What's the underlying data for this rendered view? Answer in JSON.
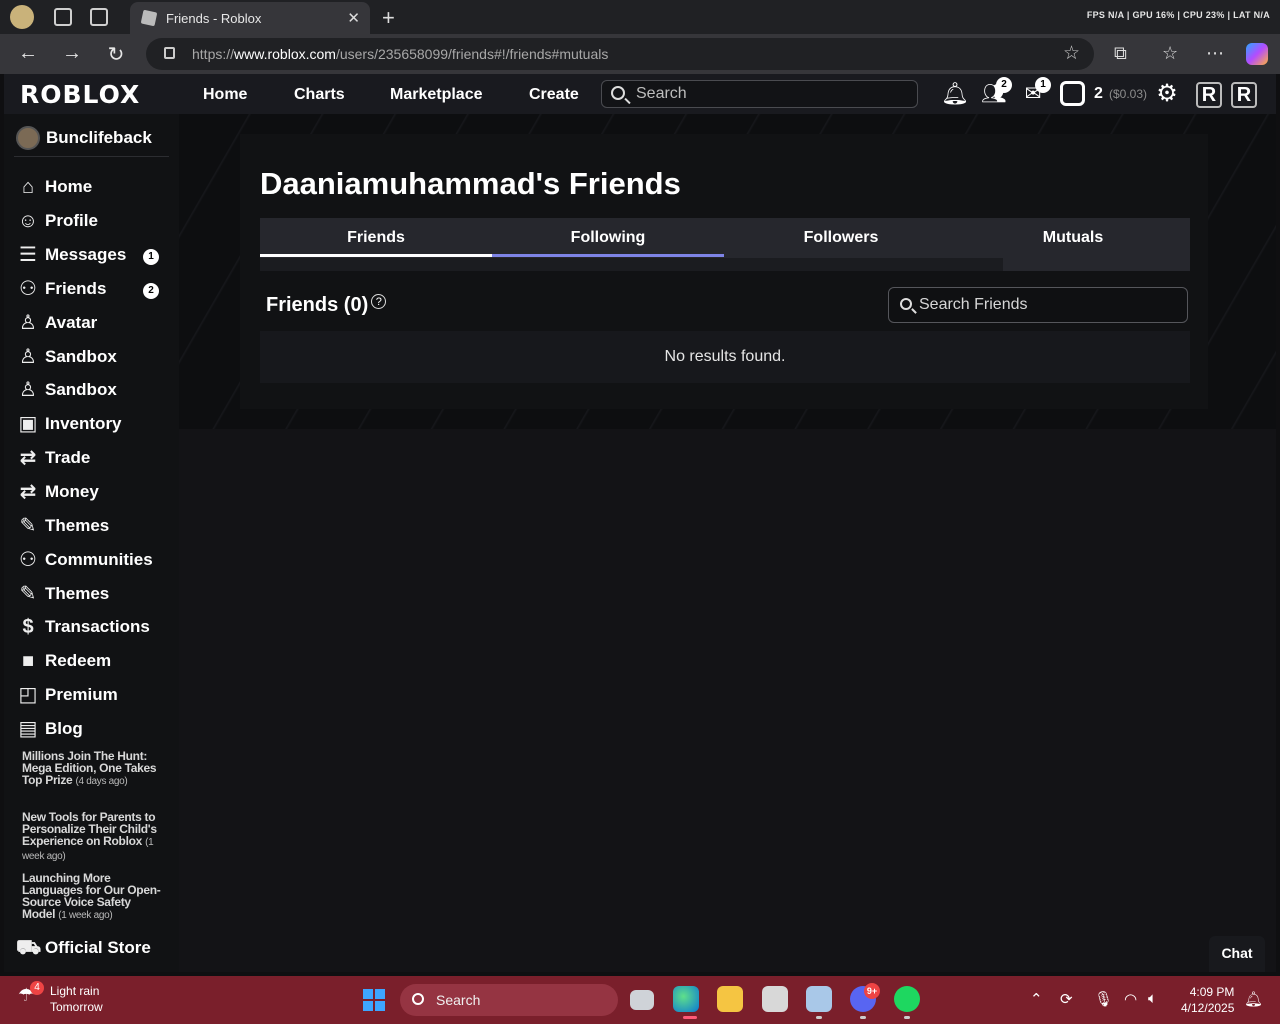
{
  "browser": {
    "tab_title": "Friends - Roblox",
    "url_prefix": "https://",
    "url_host": "www.roblox.com",
    "url_path": "/users/235658099/friends#!/friends#mutuals",
    "perf_overlay": "FPS N/A | GPU 16% | CPU 23% | LAT N/A"
  },
  "rbx_nav": {
    "logo": "ROBLOX",
    "links": [
      "Home",
      "Charts",
      "Marketplace",
      "Create"
    ],
    "search_placeholder": "Search",
    "friends_badge": "2",
    "messages_badge": "1",
    "robux_count": "2",
    "robux_usd": "($0.03)"
  },
  "sidebar": {
    "username": "Bunclifeback",
    "items": [
      {
        "label": "Home",
        "icon": "home-icon"
      },
      {
        "label": "Profile",
        "icon": "profile-icon"
      },
      {
        "label": "Messages",
        "icon": "messages-icon",
        "count": "1"
      },
      {
        "label": "Friends",
        "icon": "friends-icon",
        "count": "2"
      },
      {
        "label": "Avatar",
        "icon": "avatar-icon"
      },
      {
        "label": "Sandbox",
        "icon": "sandbox-icon"
      },
      {
        "label": "Sandbox",
        "icon": "sandbox-icon"
      },
      {
        "label": "Inventory",
        "icon": "inventory-icon"
      },
      {
        "label": "Trade",
        "icon": "trade-icon"
      },
      {
        "label": "Money",
        "icon": "money-icon"
      },
      {
        "label": "Themes",
        "icon": "themes-icon"
      },
      {
        "label": "Communities",
        "icon": "communities-icon"
      },
      {
        "label": "Themes",
        "icon": "themes-icon"
      },
      {
        "label": "Transactions",
        "icon": "transactions-icon"
      },
      {
        "label": "Redeem",
        "icon": "redeem-icon"
      },
      {
        "label": "Premium",
        "icon": "premium-icon"
      },
      {
        "label": "Blog",
        "icon": "blog-icon"
      }
    ],
    "blog": [
      {
        "title": "Millions Join The Hunt: Mega Edition, One Takes Top Prize",
        "ago": "(4 days ago)"
      },
      {
        "title": "New Tools for Parents to Personalize Their Child's Experience on Roblox",
        "ago": "(1 week ago)"
      },
      {
        "title": "Launching More Languages for Our Open-Source Voice Safety Model",
        "ago": "(1 week ago)"
      }
    ],
    "official_store": "Official Store"
  },
  "main": {
    "page_title": "Daaniamuhammad's Friends",
    "tabs": [
      "Friends",
      "Following",
      "Followers",
      "Mutuals"
    ],
    "section_title": "Friends (0)",
    "help_glyph": "?",
    "search_placeholder": "Search Friends",
    "empty_message": "No results found."
  },
  "chat_label": "Chat",
  "taskbar": {
    "weather_badge": "4",
    "weather_line1": "Light rain",
    "weather_line2": "Tomorrow",
    "search_label": "Search",
    "discord_badge": "9+",
    "time": "4:09 PM",
    "date": "4/12/2025"
  }
}
